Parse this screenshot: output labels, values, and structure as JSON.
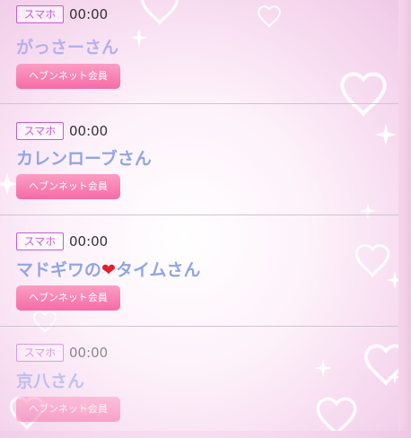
{
  "listings": [
    {
      "badge": "スマホ",
      "time": "00:00",
      "name": "がっさーさん",
      "member_label": "ヘブンネット会員"
    },
    {
      "badge": "スマホ",
      "time": "00:00",
      "name": "カレンローブさん",
      "member_label": "ヘブンネット会員"
    },
    {
      "badge": "スマホ",
      "time": "00:00",
      "name_before": "マドギワの",
      "name_emoji": "❤",
      "name_after": "タイムさん",
      "member_label": "ヘブンネット会員"
    },
    {
      "badge": "スマホ",
      "time": "00:00",
      "name": "京八さん",
      "member_label": "ヘブンネット会員"
    }
  ],
  "colors": {
    "badge": "#c95bd9",
    "name": "#8fa5e8",
    "button": "#f66ba7",
    "heart": "#e0202c"
  }
}
